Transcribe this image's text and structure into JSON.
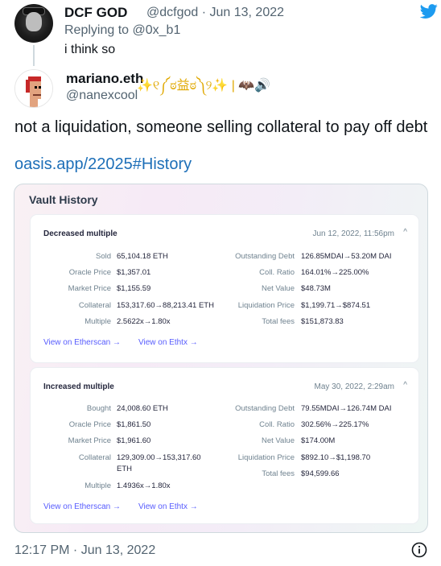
{
  "reply": {
    "name": "DCF GOD",
    "meta": "@dcfgod · Jun 13, 2022",
    "replying_prefix": "Replying to ",
    "replying_handle": "@0x_b1",
    "text": "i think so"
  },
  "author": {
    "name": "mariano.eth",
    "name_emoji": "✨୧༼ಠ益ಠ༽୨✨ | 🦇🔊",
    "handle": "@nanexcool"
  },
  "tweet": {
    "text": "not a liquidation, someone selling collateral to pay off debt",
    "link": "oasis.app/22025#History"
  },
  "card": {
    "title": "Vault History",
    "panels": [
      {
        "title": "Decreased multiple",
        "date": "Jun 12, 2022, 11:56pm",
        "left": [
          {
            "label": "Sold",
            "value": "65,104.18 ETH"
          },
          {
            "label": "Oracle Price",
            "value": "$1,357.01"
          },
          {
            "label": "Market Price",
            "value": "$1,155.59"
          },
          {
            "label": "Collateral",
            "value": "153,317.60→88,213.41 ETH"
          },
          {
            "label": "Multiple",
            "value": "2.5622x→1.80x"
          }
        ],
        "right": [
          {
            "label": "Outstanding Debt",
            "value": "126.85MDAI→53.20M DAI"
          },
          {
            "label": "Coll. Ratio",
            "value": "164.01%→225.00%"
          },
          {
            "label": "Net Value",
            "value": "$48.73M"
          },
          {
            "label": "Liquidation Price",
            "value": "$1,199.71→$874.51"
          },
          {
            "label": "Total fees",
            "value": "$151,873.83"
          }
        ],
        "link_etherscan": "View on Etherscan →",
        "link_ethtx": "View on Ethtx →"
      },
      {
        "title": "Increased multiple",
        "date": "May 30, 2022, 2:29am",
        "left": [
          {
            "label": "Bought",
            "value": "24,008.60 ETH"
          },
          {
            "label": "Oracle Price",
            "value": "$1,861.50"
          },
          {
            "label": "Market Price",
            "value": "$1,961.60"
          },
          {
            "label": "Collateral",
            "value": "129,309.00→153,317.60"
          },
          {
            "label": "",
            "value": "ETH"
          },
          {
            "label": "Multiple",
            "value": "1.4936x→1.80x"
          }
        ],
        "right": [
          {
            "label": "Outstanding Debt",
            "value": "79.55MDAI→126.74M DAI"
          },
          {
            "label": "Coll. Ratio",
            "value": "302.56%→225.17%"
          },
          {
            "label": "Net Value",
            "value": "$174.00M"
          },
          {
            "label": "Liquidation Price",
            "value": "$892.10→$1,198.70"
          },
          {
            "label": "Total fees",
            "value": "$94,599.66"
          }
        ],
        "link_etherscan": "View on Etherscan →",
        "link_ethtx": "View on Ethtx →"
      }
    ]
  },
  "footer": {
    "time": "12:17 PM · Jun 13, 2022"
  },
  "colors": {
    "twitter_blue": "#1d9bf0",
    "link": "#1d6fb8",
    "oasis_link": "#575cfe"
  },
  "icons": {
    "logo": "twitter-bird-icon",
    "info": "info-icon",
    "chevron": "chevron-up-icon"
  }
}
